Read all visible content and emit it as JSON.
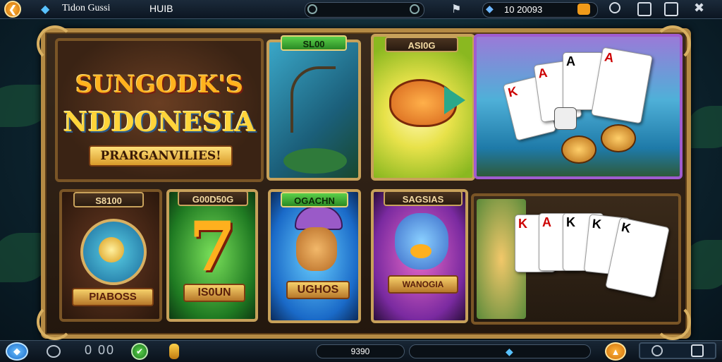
{
  "top_bar": {
    "left_title": "Tidon Gussi",
    "left_subtitle": "HUIB",
    "balance": "10 20093",
    "back_icon": "back-arrow-icon",
    "diamond_icon": "diamond-icon"
  },
  "hero": {
    "title_line1": "SUNGODK'S",
    "title_line2": "NDDONESIA",
    "subtitle": "PRARGANVILIES!"
  },
  "tiles": {
    "fishing_tag": "SL00",
    "fish_tag": "ASI0G",
    "slot7_tag": "S8100",
    "slot7_tag2": "G00D50G",
    "slot7_label": "IS0UN",
    "orb_label": "PIABOSS",
    "hat_tag": "OGACHN",
    "hat_label": "UGHOS",
    "creature_tag": "SAGSIAS",
    "creature_label": "WANOGIA"
  },
  "bottom_bar": {
    "center_value": "9390"
  },
  "colors": {
    "frame_gold": "#c7a15a",
    "accent_green": "#3fb23a",
    "accent_orange": "#f09a1a",
    "accent_blue": "#2b8fe0"
  }
}
